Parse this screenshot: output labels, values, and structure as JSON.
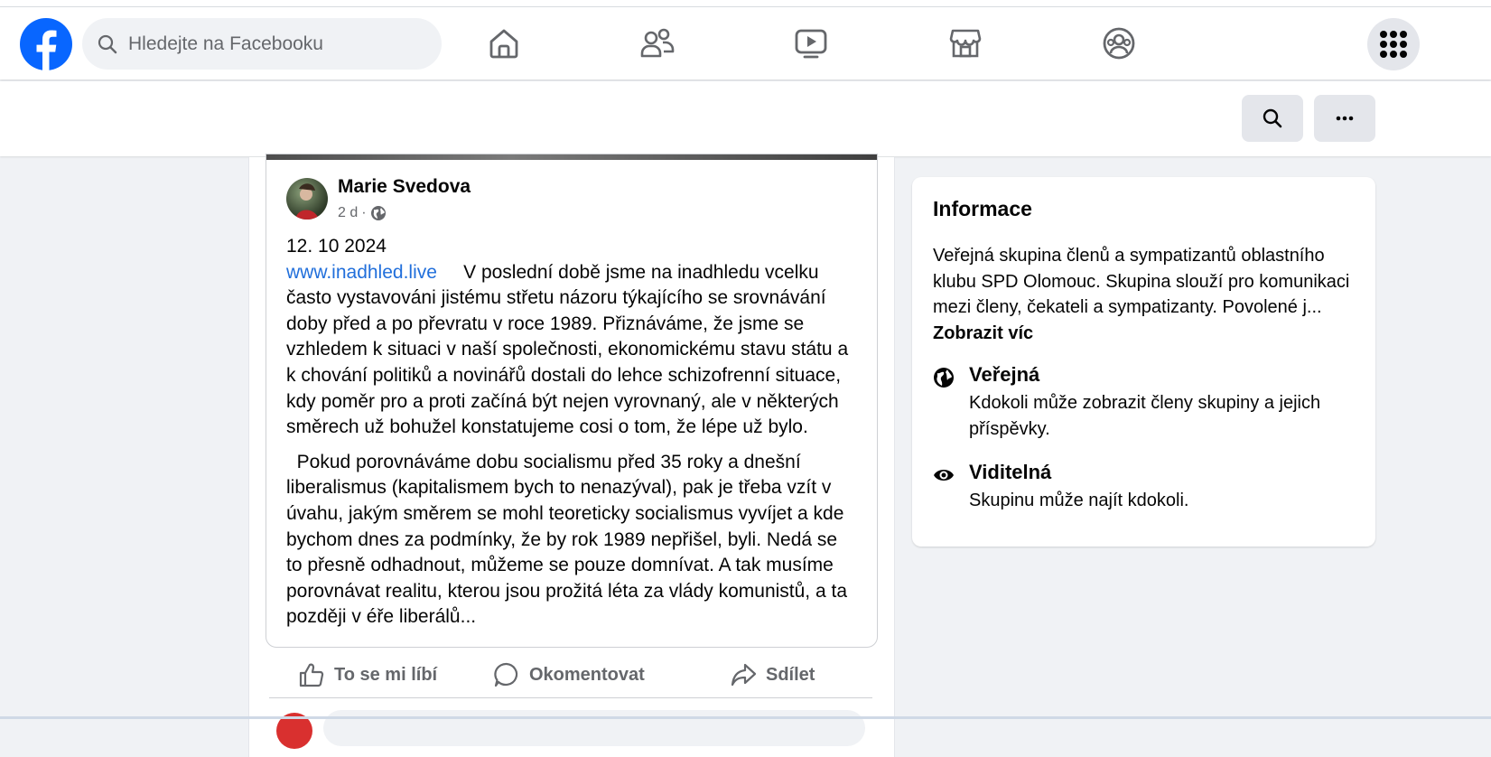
{
  "topbar": {
    "search_placeholder": "Hledejte na Facebooku",
    "nav_icons": [
      "home-icon",
      "friends-icon",
      "watch-icon",
      "marketplace-icon",
      "groups-icon"
    ],
    "menu_icon": "grid-menu-icon",
    "brand_color": "#0866ff"
  },
  "subbar": {
    "buttons": [
      "search-icon",
      "more-icon"
    ]
  },
  "post": {
    "author": "Marie Svedova",
    "time": "2 d",
    "separator": "·",
    "privacy_icon": "globe-icon",
    "date_line": "12. 10 2024",
    "link_text": "www.inadhled.live",
    "paragraph1_rest": "     V poslední době jsme na inadhledu vcelku často vystavováni jistému střetu názoru týkajícího se srovnávání doby před a po převratu v roce 1989. Přiznáváme, že jsme se vzhledem k situaci v naší společnosti, ekonomickému stavu státu a k chování politiků a novinářů dostali do lehce schizofrenní situace, kdy poměr pro a proti začíná být nejen vyrovnaný, ale v některých směrech už bohužel konstatujeme cosi o tom, že lépe už bylo.",
    "paragraph2": "  Pokud porovnáváme dobu socialismu před 35 roky a dnešní liberalismus (kapitalismem bych to nenazýval), pak je třeba vzít v úvahu, jakým směrem se mohl teoreticky socialismus vyvíjet a kde bychom dnes za podmínky, že by rok 1989 nepřišel, byli. Nedá se to přesně odhadnout, můžeme se pouze domnívat. A tak musíme porovnávat realitu, kterou jsou prožitá léta za vlády komunistů, a ta později v éře liberálů..."
  },
  "actions": {
    "like": "To se mi líbí",
    "comment": "Okomentovat",
    "share": "Sdílet"
  },
  "info": {
    "title": "Informace",
    "description": "Veřejná skupina členů a sympatizantů oblastního klubu SPD Olomouc. Skupina slouží pro komunikaci mezi členy, čekateli a sympatizanty. Povolené j... ",
    "see_more": "Zobrazit víc",
    "public_title": "Veřejná",
    "public_desc": "Kdokoli může zobrazit členy skupiny a jejich příspěvky.",
    "visible_title": "Viditelná",
    "visible_desc": "Skupinu může najít kdokoli."
  }
}
